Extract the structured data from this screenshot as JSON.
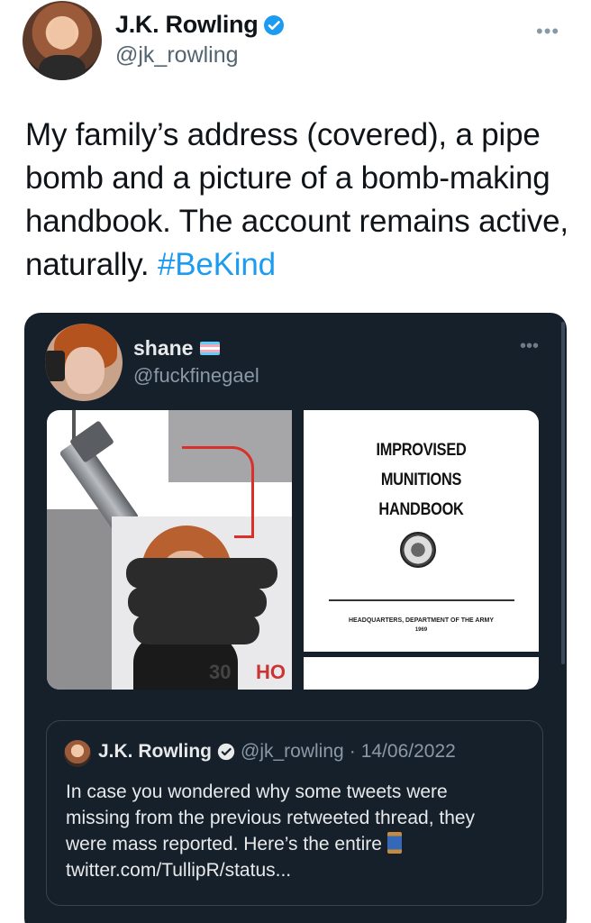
{
  "tweet": {
    "display_name": "J.K. Rowling",
    "handle": "@jk_rowling",
    "more_icon": "•••",
    "text": "My family’s address (covered), a pipe bomb and a picture of a bomb-making handbook. The account remains active, naturally.",
    "hashtag": "#BeKind",
    "colors": {
      "link": "#1d9bf0",
      "verified": "#1d9bf0"
    }
  },
  "embedded": {
    "display_name": "shane",
    "handle": "@fuckfinegael",
    "more_icon": "•••",
    "flag_colors": [
      "#5bcefa",
      "#f5a9b8",
      "#ffffff",
      "#f5a9b8",
      "#5bcefa"
    ],
    "book": {
      "title_line1": "IMPROVISED",
      "title_line2": "MUNITIONS",
      "title_line3": "HANDBOOK",
      "footer": "HEADQUARTERS, DEPARTMENT OF THE ARMY",
      "year": "1969"
    },
    "quote": {
      "display_name": "J.K. Rowling",
      "handle": "@jk_rowling",
      "separator": "·",
      "date": "14/06/2022",
      "text": "In case you wondered why some tweets were missing from the previous retweeted thread, they were mass reported. Here’s the entire",
      "link": "twitter.com/TullipR/status..."
    }
  }
}
